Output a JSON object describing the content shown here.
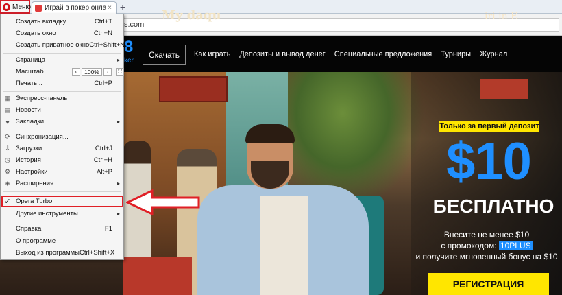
{
  "browser": {
    "menu_button_label": "Меню",
    "tab_title": "Играй в покер онлайн -",
    "tab_close": "×",
    "new_tab": "+",
    "address_visible": "s.com"
  },
  "site": {
    "logo_fragment": "8",
    "logo_sub": "ker",
    "download_button": "Скачать",
    "nav": [
      "Как играть",
      "Депозиты и вывод денег",
      "Специальные предложения",
      "Турниры",
      "Журнал"
    ],
    "scene_sign": "My daqu",
    "scene_sign_right": "iri in E"
  },
  "promo": {
    "badge": "Только за первый депозит",
    "amount": "$10",
    "free": "БЕСПЛАТНО",
    "line1": "Внесите не менее $10",
    "line2_prefix": "с промокодом: ",
    "code": "10PLUS",
    "line3": "и получите мгновенный бонус на $10",
    "register_button": "РЕГИСТРАЦИЯ"
  },
  "menu": {
    "items": [
      {
        "label": "Создать вкладку",
        "shortcut": "Ctrl+T",
        "icon": ""
      },
      {
        "label": "Создать окно",
        "shortcut": "Ctrl+N",
        "icon": ""
      },
      {
        "label": "Создать приватное окно",
        "shortcut": "Ctrl+Shift+N",
        "icon": ""
      },
      {
        "label": "Страница",
        "shortcut": "",
        "icon": "",
        "submenu": true
      },
      {
        "label": "Масштаб",
        "shortcut": "",
        "icon": "",
        "zoom": "100%"
      },
      {
        "label": "Печать...",
        "shortcut": "Ctrl+P",
        "icon": ""
      },
      {
        "label": "Экспресс-панель",
        "shortcut": "",
        "icon": "speed-dial-icon"
      },
      {
        "label": "Новости",
        "shortcut": "",
        "icon": "news-icon"
      },
      {
        "label": "Закладки",
        "shortcut": "",
        "icon": "heart-icon",
        "submenu": true
      },
      {
        "label": "Синхронизация...",
        "shortcut": "",
        "icon": "sync-icon"
      },
      {
        "label": "Загрузки",
        "shortcut": "Ctrl+J",
        "icon": "downloads-icon"
      },
      {
        "label": "История",
        "shortcut": "Ctrl+H",
        "icon": "history-icon"
      },
      {
        "label": "Настройки",
        "shortcut": "Alt+P",
        "icon": "gear-icon"
      },
      {
        "label": "Расширения",
        "shortcut": "",
        "icon": "extensions-icon",
        "submenu": true
      },
      {
        "label": "Opera Turbo",
        "shortcut": "",
        "icon": "checkmark-icon",
        "checked": true
      },
      {
        "label": "Другие инструменты",
        "shortcut": "",
        "icon": "",
        "submenu": true
      },
      {
        "label": "Справка",
        "shortcut": "F1",
        "icon": ""
      },
      {
        "label": "О программе",
        "shortcut": "",
        "icon": ""
      },
      {
        "label": "Выход из программы",
        "shortcut": "Ctrl+Shift+X",
        "icon": ""
      }
    ],
    "zoom_minus": "‹",
    "zoom_plus": "›",
    "zoom_fullscreen": "⛶"
  },
  "colors": {
    "opera_red": "#d0111b",
    "annotation_red": "#e01f26",
    "brand_blue": "#1f8fff",
    "promo_yellow": "#ffe600"
  }
}
